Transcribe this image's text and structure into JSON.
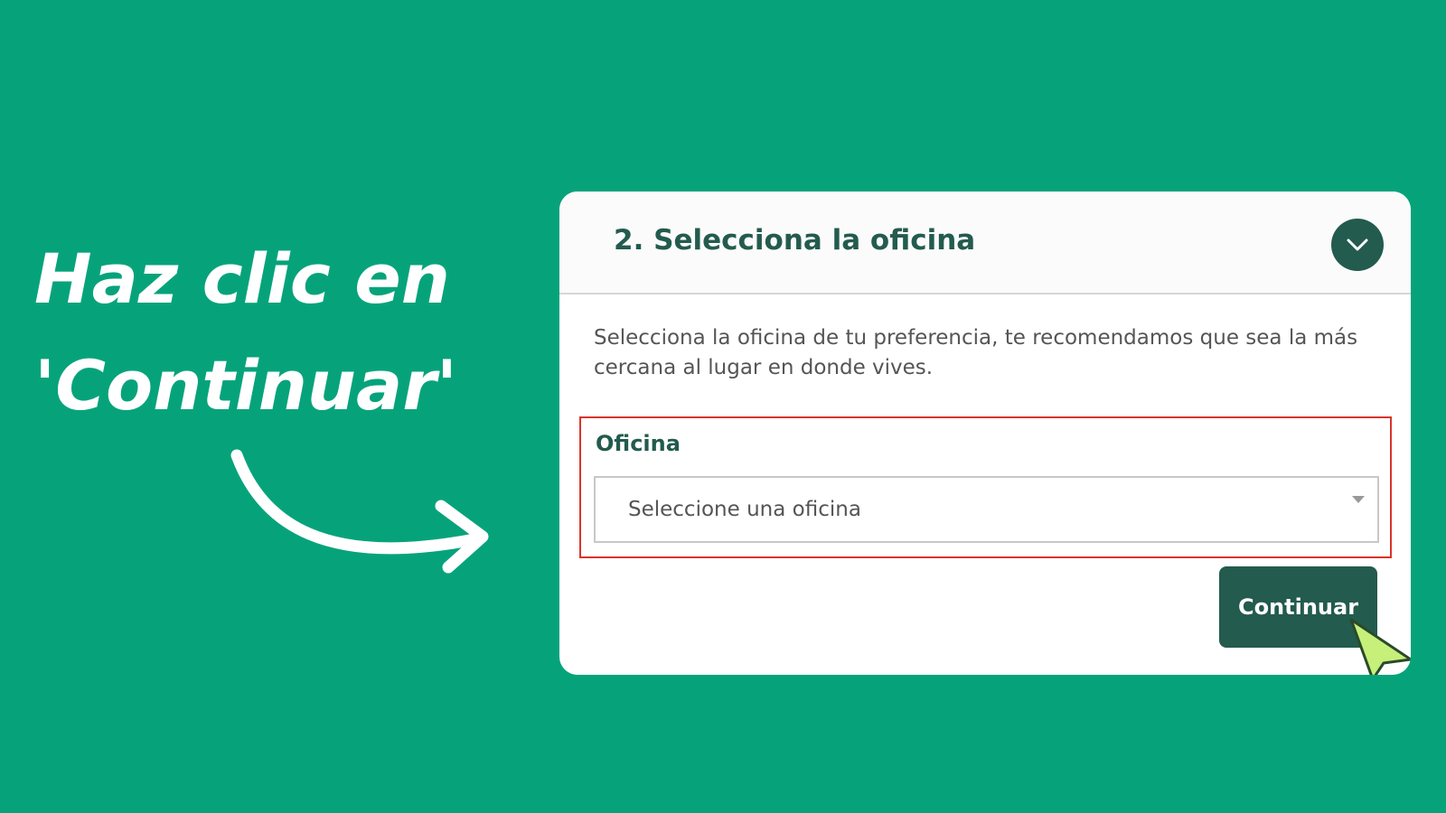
{
  "headline": {
    "line1": "Haz clic en",
    "line2": "'Continuar'"
  },
  "card": {
    "title": "2. Selecciona la oficina",
    "description": "Selecciona la oficina de tu preferencia, te recomendamos que sea la más cercana al lugar en donde vives.",
    "field": {
      "label": "Oficina",
      "placeholder": "Seleccione una oficina"
    },
    "continue_label": "Continuar"
  },
  "colors": {
    "background": "#06a37b",
    "brand": "#235b4e",
    "highlight_border": "#d9342b",
    "cursor": "#c6f07a"
  },
  "icons": {
    "toggle": "chevron-down-icon",
    "arrow": "curved-arrow-icon",
    "cursor": "pointer-cursor-icon",
    "caret": "caret-down-icon"
  }
}
